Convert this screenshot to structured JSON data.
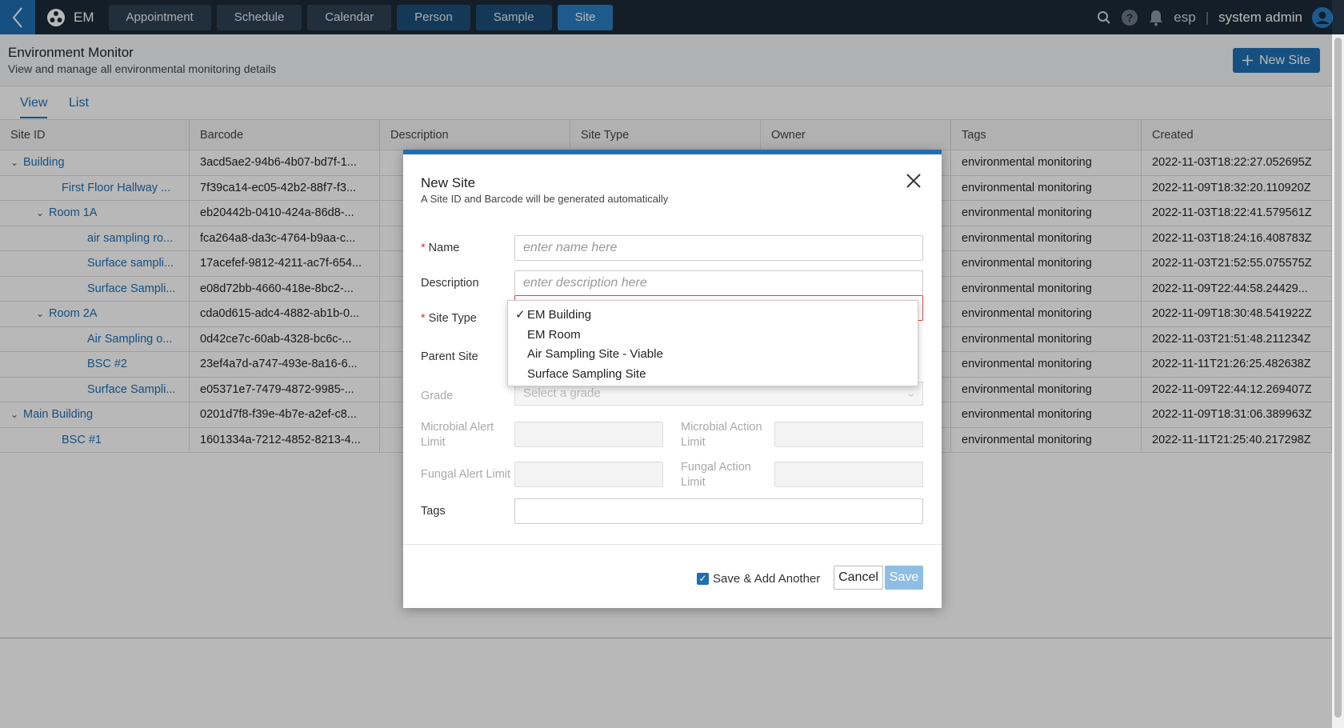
{
  "nav": {
    "app_name": "EM",
    "tabs": [
      {
        "label": "Appointment"
      },
      {
        "label": "Schedule"
      },
      {
        "label": "Calendar"
      },
      {
        "label": "Person"
      },
      {
        "label": "Sample"
      },
      {
        "label": "Site"
      }
    ],
    "active_tab": "Site",
    "tenant": "esp",
    "separator": "|",
    "user": "system admin"
  },
  "header": {
    "title": "Environment Monitor",
    "subtitle": "View and manage all environmental monitoring details",
    "new_site_label": "New Site"
  },
  "view_tabs": [
    {
      "label": "View"
    },
    {
      "label": "List"
    }
  ],
  "table": {
    "columns": [
      "Site ID",
      "Barcode",
      "Description",
      "Site Type",
      "Owner",
      "Tags",
      "Created"
    ],
    "rows": [
      {
        "site_id": "Building",
        "barcode": "3acd5ae2-94b6-4b07-bd7f-1...",
        "tags": "environmental monitoring",
        "created": "2022-11-03T18:22:27.052695Z"
      },
      {
        "site_id": "First Floor Hallway ...",
        "barcode": "7f39ca14-ec05-42b2-88f7-f3...",
        "tags": "environmental monitoring",
        "created": "2022-11-09T18:32:20.110920Z"
      },
      {
        "site_id": "Room 1A",
        "barcode": "eb20442b-0410-424a-86d8-...",
        "tags": "environmental monitoring",
        "created": "2022-11-03T18:22:41.579561Z"
      },
      {
        "site_id": "air sampling ro...",
        "barcode": "fca264a8-da3c-4764-b9aa-c...",
        "tags": "environmental monitoring",
        "created": "2022-11-03T18:24:16.408783Z"
      },
      {
        "site_id": "Surface sampli...",
        "barcode": "17acefef-9812-4211-ac7f-654...",
        "tags": "environmental monitoring",
        "created": "2022-11-03T21:52:55.075575Z"
      },
      {
        "site_id": "Surface Sampli...",
        "barcode": "e08d72bb-4660-418e-8bc2-...",
        "tags": "environmental monitoring",
        "created": "2022-11-09T22:44:58.24429..."
      },
      {
        "site_id": "Room 2A",
        "barcode": "cda0d615-adc4-4882-ab1b-0...",
        "tags": "environmental monitoring",
        "created": "2022-11-09T18:30:48.541922Z"
      },
      {
        "site_id": "Air Sampling o...",
        "barcode": "0d42ce7c-60ab-4328-bc6c-...",
        "tags": "environmental monitoring",
        "created": "2022-11-03T21:51:48.211234Z"
      },
      {
        "site_id": "BSC #2",
        "barcode": "23ef4a7d-a747-493e-8a16-6...",
        "tags": "environmental monitoring",
        "created": "2022-11-11T21:26:25.482638Z"
      },
      {
        "site_id": "Surface Sampli...",
        "barcode": "e05371e7-7479-4872-9985-...",
        "tags": "environmental monitoring",
        "created": "2022-11-09T22:44:12.269407Z"
      },
      {
        "site_id": "Main Building",
        "barcode": "0201d7f8-f39e-4b7e-a2ef-c8...",
        "tags": "environmental monitoring",
        "created": "2022-11-09T18:31:06.389963Z"
      },
      {
        "site_id": "BSC #1",
        "barcode": "1601334a-7212-4852-8213-4...",
        "tags": "environmental monitoring",
        "created": "2022-11-11T21:25:40.217298Z"
      }
    ]
  },
  "modal": {
    "title": "New Site",
    "subtitle": "A Site ID and Barcode will be generated automatically",
    "required_marker": "*",
    "name_label": "Name",
    "name_placeholder": "enter name here",
    "description_label": "Description",
    "description_placeholder": "enter description here",
    "site_type_label": "Site Type",
    "site_type_options": [
      "EM Building",
      "EM Room",
      "Air Sampling Site - Viable",
      "Surface Sampling Site"
    ],
    "site_type_selected": "EM Building",
    "check_mark": "✓",
    "parent_site_label": "Parent Site",
    "grade_label": "Grade",
    "grade_placeholder": "Select a grade",
    "microbial_alert_label": "Microbial Alert Limit",
    "microbial_action_label": "Microbial Action Limit",
    "fungal_alert_label": "Fungal Alert Limit",
    "fungal_action_label": "Fungal Action Limit",
    "tags_label": "Tags",
    "save_add_another_label": "Save & Add Another",
    "cancel_label": "Cancel",
    "save_label": "Save"
  },
  "colors": {
    "primary": "#1f6fb2",
    "nav_bg": "#1c2a38",
    "required": "#d33"
  }
}
